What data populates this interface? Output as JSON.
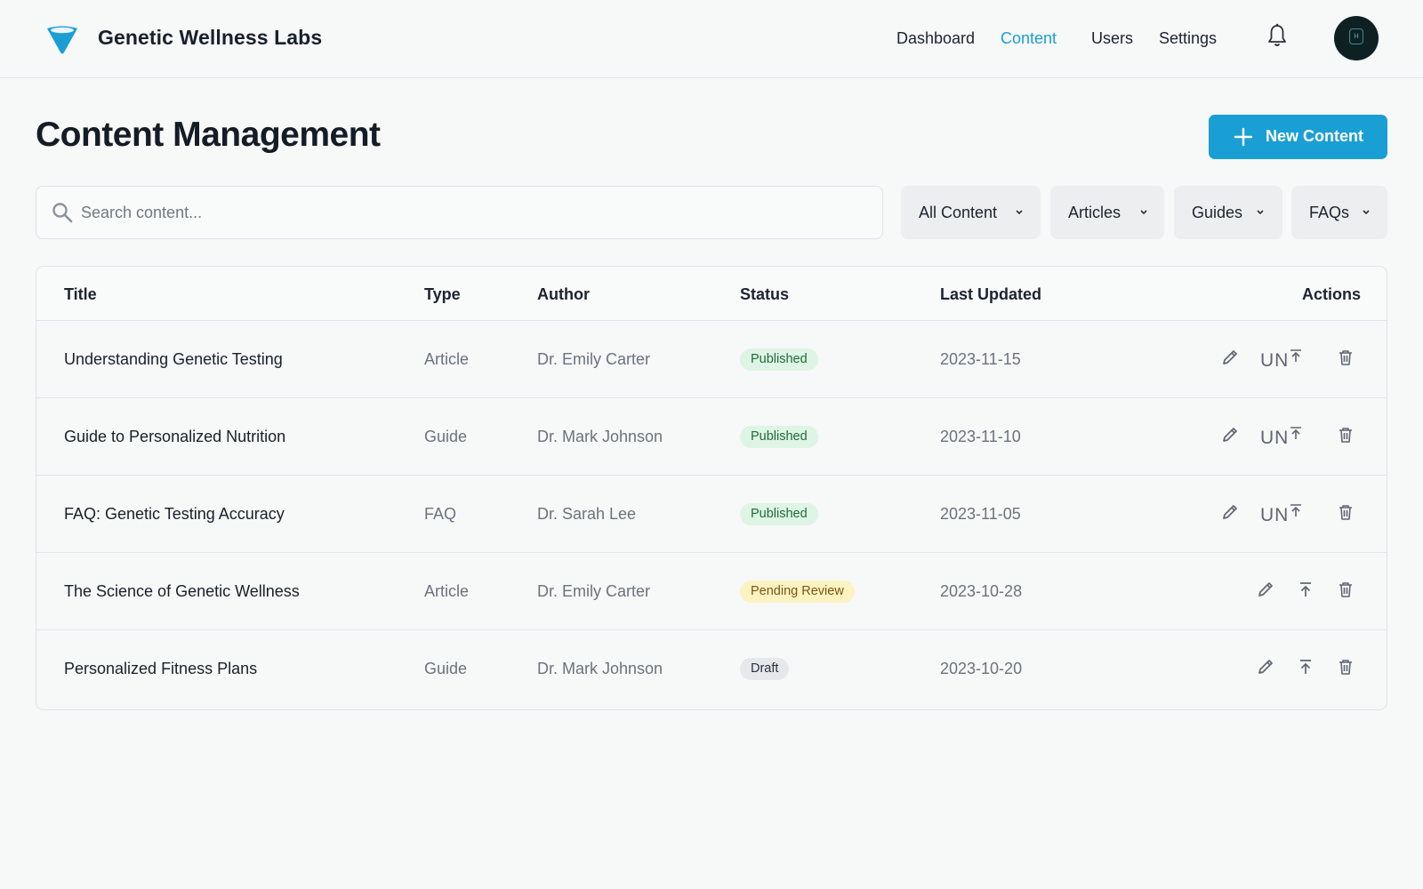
{
  "header": {
    "brand": "Genetic Wellness Labs",
    "nav": [
      "Dashboard",
      "Content",
      "Users",
      "Settings"
    ],
    "active_nav": "Content",
    "accent_color": "#1a9fd4"
  },
  "page": {
    "title": "Content Management",
    "new_button_label": "New Content"
  },
  "search": {
    "placeholder": "Search content..."
  },
  "filters": [
    "All Content",
    "Articles",
    "Guides",
    "FAQs"
  ],
  "table": {
    "columns": [
      "Title",
      "Type",
      "Author",
      "Status",
      "Last Updated",
      "Actions"
    ],
    "rows": [
      {
        "title": "Understanding Genetic Testing",
        "type": "Article",
        "author": "Dr. Emily Carter",
        "status": "Published",
        "updated": "2023-11-15",
        "unpublish_text": "UN"
      },
      {
        "title": "Guide to Personalized Nutrition",
        "type": "Guide",
        "author": "Dr. Mark Johnson",
        "status": "Published",
        "updated": "2023-11-10",
        "unpublish_text": "UN"
      },
      {
        "title": "FAQ: Genetic Testing Accuracy",
        "type": "FAQ",
        "author": "Dr. Sarah Lee",
        "status": "Published",
        "updated": "2023-11-05",
        "unpublish_text": "UN"
      },
      {
        "title": "The Science of Genetic Wellness",
        "type": "Article",
        "author": "Dr. Emily Carter",
        "status": "Pending Review",
        "updated": "2023-10-28"
      },
      {
        "title": "Personalized Fitness Plans",
        "type": "Guide",
        "author": "Dr. Mark Johnson",
        "status": "Draft",
        "updated": "2023-10-20"
      }
    ]
  }
}
